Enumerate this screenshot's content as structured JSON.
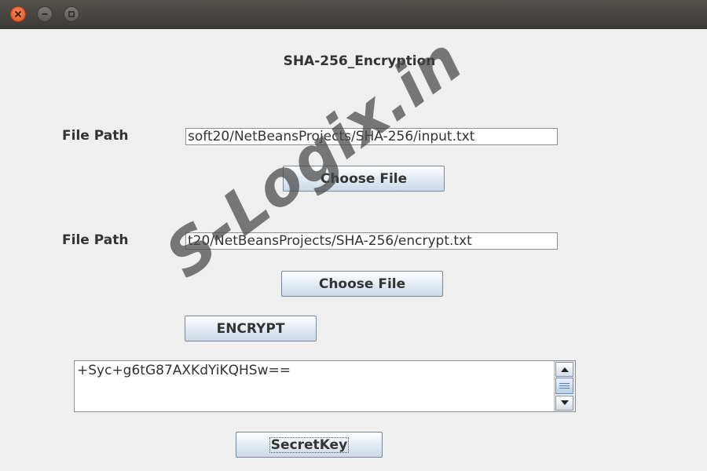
{
  "app": {
    "title": "SHA-256_Encryption"
  },
  "window_controls": {
    "close_icon": "close-icon",
    "minimize_icon": "minimize-icon",
    "maximize_icon": "maximize-icon"
  },
  "form": {
    "input_file": {
      "label": "File Path",
      "value": "soft20/NetBeansProjects/SHA-256/input.txt",
      "button_label": "Choose File"
    },
    "output_file": {
      "label": "File Path",
      "value": "t20/NetBeansProjects/SHA-256/encrypt.txt",
      "button_label": "Choose File"
    },
    "encrypt_label": "ENCRYPT",
    "output_text": "+Syc+g6tG87AXKdYiKQHSw==",
    "secretkey_label": "SecretKey"
  },
  "watermark": "S-Logix.in",
  "colors": {
    "close_button": "#e2541f",
    "titlebar": "#45433f",
    "background": "#efefef",
    "button_gradient_end": "#cdd9e6"
  }
}
